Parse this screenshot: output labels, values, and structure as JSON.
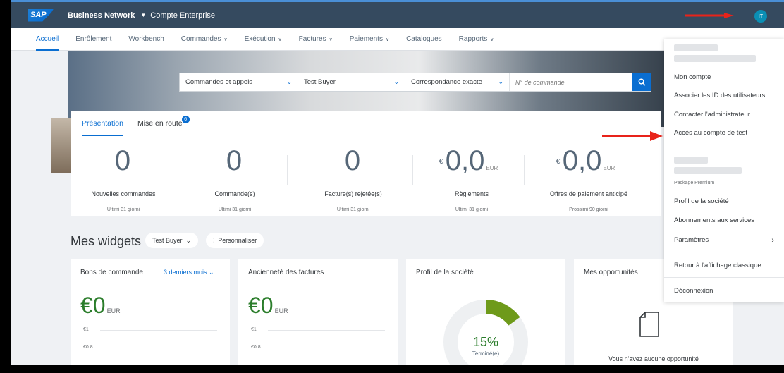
{
  "shell": {
    "logo": "SAP",
    "title": "Business Network",
    "subtitle": "Compte Enterprise",
    "avatar_initials": "IT"
  },
  "nav": {
    "items": [
      {
        "label": "Accueil",
        "has_dropdown": false
      },
      {
        "label": "Enrôlement",
        "has_dropdown": false
      },
      {
        "label": "Workbench",
        "has_dropdown": false
      },
      {
        "label": "Commandes",
        "has_dropdown": true
      },
      {
        "label": "Exécution",
        "has_dropdown": true
      },
      {
        "label": "Factures",
        "has_dropdown": true
      },
      {
        "label": "Paiements",
        "has_dropdown": true
      },
      {
        "label": "Catalogues",
        "has_dropdown": false
      },
      {
        "label": "Rapports",
        "has_dropdown": true
      }
    ]
  },
  "search": {
    "scope": "Commandes et appels",
    "customer": "Test Buyer",
    "match": "Correspondance exacte",
    "placeholder": "N° de commande"
  },
  "overview": {
    "tabs": [
      {
        "label": "Présentation",
        "active": true
      },
      {
        "label": "Mise en route",
        "badge": "6"
      }
    ],
    "kpis": [
      {
        "currency": "",
        "value": "0",
        "unit": "",
        "label": "Nouvelles commandes",
        "period": "Ultimi 31 giorni"
      },
      {
        "currency": "",
        "value": "0",
        "unit": "",
        "label": "Commande(s)",
        "period": "Ultimi 31 giorni"
      },
      {
        "currency": "",
        "value": "0",
        "unit": "",
        "label": "Facture(s) rejetée(s)",
        "period": "Ultimi 31 giorni"
      },
      {
        "currency": "€",
        "value": "0,0",
        "unit": "EUR",
        "label": "Règlements",
        "period": "Ultimi 31 giorni"
      },
      {
        "currency": "€",
        "value": "0,0",
        "unit": "EUR",
        "label": "Offres de paiement anticipé",
        "period": "Prossimi 90 giorni"
      }
    ]
  },
  "widgets": {
    "title": "Mes widgets",
    "buyer_filter": "Test Buyer",
    "customize": "Personnaliser",
    "cards": {
      "orders": {
        "title": "Bons de commande",
        "range": "3 derniers mois",
        "amount": "€0",
        "unit": "EUR",
        "axis": [
          "€1",
          "€0.8"
        ]
      },
      "aging": {
        "title": "Ancienneté des factures",
        "amount": "€0",
        "unit": "EUR",
        "axis": [
          "€1",
          "€0.8"
        ]
      },
      "profile": {
        "title": "Profil de la société",
        "percent": 15,
        "percent_label": "15%",
        "status": "Terminé(e)"
      },
      "opportunities": {
        "title": "Mes opportunités",
        "empty": "Vous n'avez aucune opportunité"
      }
    }
  },
  "user_menu": {
    "items": [
      "Mon compte",
      "Associer les ID des utilisateurs",
      "Contacter l'administrateur",
      "Accès au compte de test"
    ],
    "package": "Package Premium",
    "items2": [
      "Profil de la société",
      "Abonnements aux services",
      "Paramètres"
    ],
    "classic": "Retour à l'affichage classique",
    "logout": "Déconnexion"
  },
  "colors": {
    "shell": "#354a5f",
    "accent": "#0a6ed1",
    "success": "#2b7d2b",
    "donut_fill": "#6e9a1a",
    "arrow": "#e8231a"
  }
}
